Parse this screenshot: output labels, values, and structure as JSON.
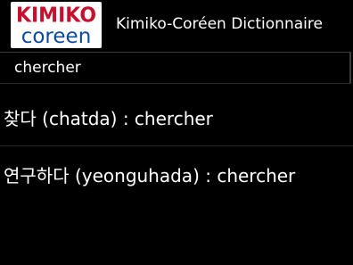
{
  "header": {
    "logo": {
      "top_text": "KIMIKO",
      "bottom_text": "coreen",
      "top_color": "#c8102e",
      "bottom_color": "#0b4a9e"
    },
    "title": "Kimiko-Coréen Dictionnaire"
  },
  "search": {
    "value": "chercher",
    "placeholder": ""
  },
  "results": [
    {
      "text": "찾다 (chatda) : chercher"
    },
    {
      "text": "연구하다 (yeonguhada) : chercher"
    }
  ],
  "colors": {
    "background": "#000000",
    "text": "#ffffff",
    "divider": "#262626"
  }
}
